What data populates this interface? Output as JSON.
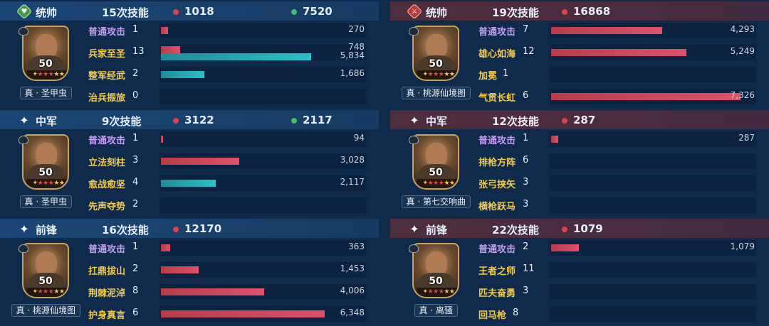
{
  "left": {
    "panels": [
      {
        "role": "统帅",
        "role_icon": "green-leader-icon",
        "skill_count": "15次技能",
        "damage": "1018",
        "heal": "7520",
        "level": "50",
        "general_name": "真 · 圣甲虫",
        "skills": [
          {
            "name": "普通攻击",
            "times": "1",
            "value": "270",
            "damage": 270,
            "heal": null
          },
          {
            "name": "兵家至圣",
            "times": "13",
            "value": "748",
            "value2": "5,834",
            "damage": 748,
            "heal": 5834
          },
          {
            "name": "整军经武",
            "times": "2",
            "value": "1,686",
            "damage": null,
            "heal": 1686
          },
          {
            "name": "治兵振旅",
            "times": "0",
            "value": "",
            "damage": null,
            "heal": null
          }
        ]
      },
      {
        "role": "中军",
        "role_icon": "star-icon",
        "skill_count": "9次技能",
        "damage": "3122",
        "heal": "2117",
        "level": "50",
        "general_name": "真 · 圣甲虫",
        "skills": [
          {
            "name": "普通攻击",
            "times": "1",
            "value": "94",
            "damage": 94,
            "heal": null
          },
          {
            "name": "立法刻柱",
            "times": "3",
            "value": "3,028",
            "damage": 3028,
            "heal": null
          },
          {
            "name": "愈战愈坚",
            "times": "4",
            "value": "2,117",
            "damage": null,
            "heal": 2117
          },
          {
            "name": "先声夺势",
            "times": "2",
            "value": "",
            "damage": null,
            "heal": null
          }
        ]
      },
      {
        "role": "前锋",
        "role_icon": "star-icon",
        "skill_count": "16次技能",
        "damage": "12170",
        "heal": "",
        "level": "50",
        "general_name": "真 · 桃源仙境图",
        "skills": [
          {
            "name": "普通攻击",
            "times": "1",
            "value": "363",
            "damage": 363,
            "heal": null
          },
          {
            "name": "扛鼎拔山",
            "times": "2",
            "value": "1,453",
            "damage": 1453,
            "heal": null
          },
          {
            "name": "荆棘泥淖",
            "times": "8",
            "value": "4,006",
            "damage": 4006,
            "heal": null
          },
          {
            "name": "护身真言",
            "times": "6",
            "value": "6,348",
            "damage": 6348,
            "heal": null
          }
        ]
      }
    ]
  },
  "right": {
    "panels": [
      {
        "role": "统帅",
        "role_icon": "red-leader-icon",
        "skill_count": "19次技能",
        "damage": "16868",
        "heal": "",
        "level": "50",
        "general_name": "真 · 桃源仙境图",
        "skills": [
          {
            "name": "普通攻击",
            "times": "7",
            "value": "4,293",
            "damage": 4293,
            "heal": null
          },
          {
            "name": "雄心如海",
            "times": "12",
            "value": "5,249",
            "damage": 5249,
            "heal": null
          },
          {
            "name": "加冕",
            "times": "1",
            "value": "",
            "damage": null,
            "heal": null
          },
          {
            "name": "气贯长虹",
            "times": "6",
            "value": "7,326",
            "damage": 7326,
            "heal": null
          }
        ]
      },
      {
        "role": "中军",
        "role_icon": "star-icon",
        "skill_count": "12次技能",
        "damage": "287",
        "heal": "",
        "level": "50",
        "general_name": "真 · 第七交响曲",
        "skills": [
          {
            "name": "普通攻击",
            "times": "1",
            "value": "287",
            "damage": 287,
            "heal": null
          },
          {
            "name": "排枪方阵",
            "times": "6",
            "value": "",
            "damage": null,
            "heal": null
          },
          {
            "name": "张弓挟矢",
            "times": "3",
            "value": "",
            "damage": null,
            "heal": null
          },
          {
            "name": "横枪跃马",
            "times": "3",
            "value": "",
            "damage": null,
            "heal": null
          }
        ]
      },
      {
        "role": "前锋",
        "role_icon": "star-icon",
        "skill_count": "22次技能",
        "damage": "1079",
        "heal": "",
        "level": "50",
        "general_name": "真 · 离骚",
        "skills": [
          {
            "name": "普通攻击",
            "times": "2",
            "value": "1,079",
            "damage": 1079,
            "heal": null
          },
          {
            "name": "王者之师",
            "times": "11",
            "value": "",
            "damage": null,
            "heal": null
          },
          {
            "name": "匹夫奋勇",
            "times": "3",
            "value": "",
            "damage": null,
            "heal": null
          },
          {
            "name": "回马枪",
            "times": "8",
            "value": "",
            "damage": null,
            "heal": null
          }
        ]
      }
    ]
  },
  "bar_scale_max": 8000,
  "colors": {
    "damage": "#d9424f",
    "heal": "#2cc0c8",
    "skill_name": "#f2c94c",
    "normal_attack": "#c49bf2"
  }
}
